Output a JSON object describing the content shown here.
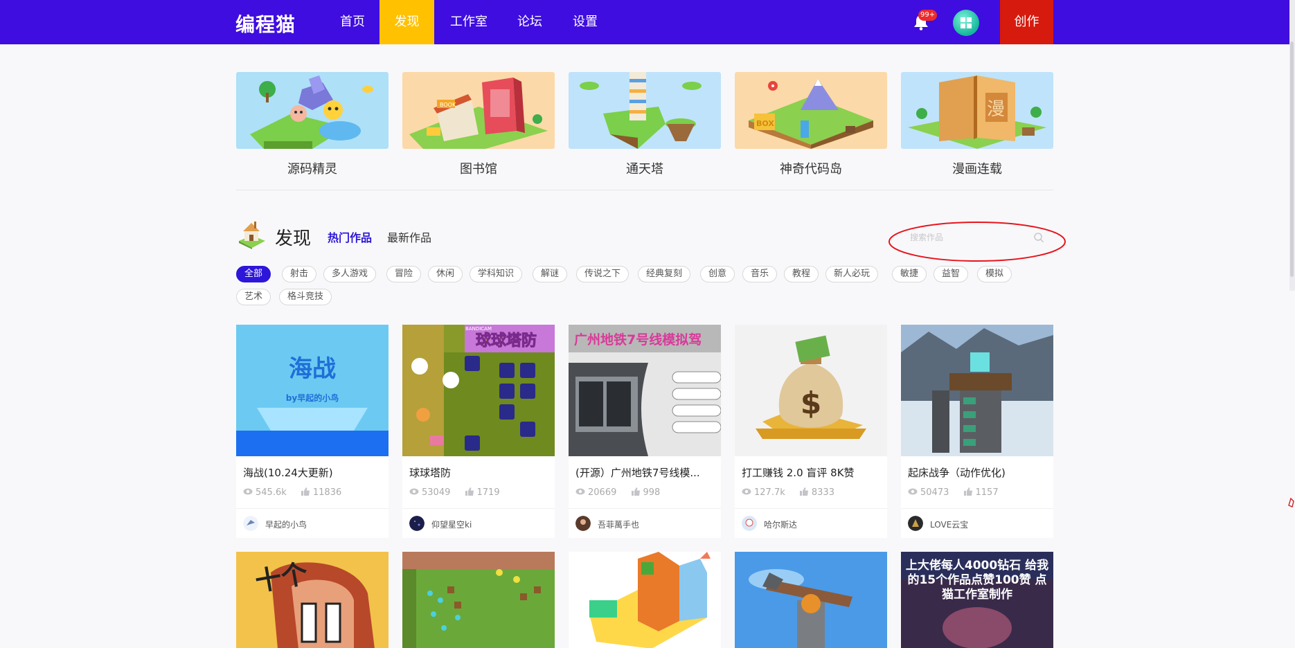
{
  "header": {
    "logo": "编程猫",
    "nav": [
      "首页",
      "发现",
      "工作室",
      "论坛",
      "设置"
    ],
    "active_nav": "发现",
    "notification_badge": "99+",
    "create_label": "创作",
    "colors": {
      "bar": "#3f0ddf",
      "active": "#ffc100",
      "create": "#d71a0e"
    }
  },
  "features": [
    {
      "label": "源码精灵"
    },
    {
      "label": "图书馆"
    },
    {
      "label": "通天塔"
    },
    {
      "label": "神奇代码岛"
    },
    {
      "label": "漫画连载"
    }
  ],
  "discover": {
    "title": "发现",
    "tab_hot": "热门作品",
    "tab_new": "最新作品",
    "search_placeholder": "搜索作品"
  },
  "tags": [
    "全部",
    "射击",
    "多人游戏",
    "冒险",
    "休闲",
    "学科知识",
    "解谜",
    "传说之下",
    "经典复刻",
    "创意",
    "音乐",
    "教程",
    "新人必玩",
    "敏捷",
    "益智",
    "模拟",
    "艺术",
    "格斗竞技"
  ],
  "active_tag": "全部",
  "works": [
    {
      "title": "海战(10.24大更新)",
      "views": "545.6k",
      "likes": "11836",
      "author": "早起的小鸟",
      "thumb_text": "海战",
      "thumb_sub": "by早起的小鸟"
    },
    {
      "title": "球球塔防",
      "views": "53049",
      "likes": "1719",
      "author": "仰望星空ki",
      "thumb_text": "球球塔防",
      "thumb_sub": "BANDICAM"
    },
    {
      "title": "(开源）广州地铁7号线模...",
      "views": "20669",
      "likes": "998",
      "author": "吾菲萬手也",
      "thumb_text": "广州地铁7号线模拟驾",
      "thumb_sub": ""
    },
    {
      "title": "打工赚钱 2.0 盲评 8K赞",
      "views": "127.7k",
      "likes": "8333",
      "author": "哈尔斯达",
      "thumb_text": "",
      "thumb_sub": ""
    },
    {
      "title": "起床战争（动作优化)",
      "views": "50473",
      "likes": "1157",
      "author": "LOVE云宝",
      "thumb_text": "",
      "thumb_sub": ""
    }
  ],
  "works_row2": [
    {
      "thumb_text": "十个"
    },
    {
      "thumb_text": ""
    },
    {
      "thumb_text": ""
    },
    {
      "thumb_text": ""
    },
    {
      "thumb_text": "上大佬每人4000钻石 给我的15个作品点赞100赞 点猫工作室制作"
    }
  ]
}
